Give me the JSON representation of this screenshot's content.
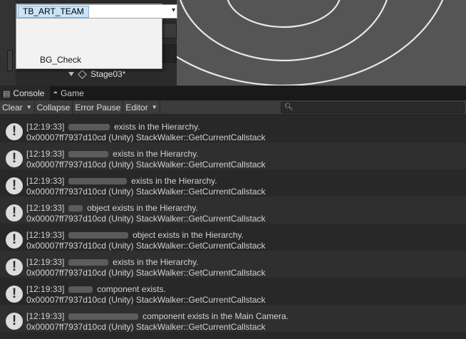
{
  "popup": {
    "selected_chip": "TB_ART_TEAM",
    "item": "BG_Check"
  },
  "hierarchy": {
    "visible_row": "Stage03*"
  },
  "tabs": [
    {
      "label": "Console",
      "icon": "console-icon",
      "active": true
    },
    {
      "label": "Game",
      "icon": "gamepad-icon",
      "active": false
    }
  ],
  "toolbar": {
    "clear": "Clear",
    "collapse": "Collapse",
    "error_pause": "Error Pause",
    "editor": "Editor",
    "search_placeholder": ""
  },
  "log_entries": [
    {
      "timestamp": "[12:19:33]",
      "message": "exists in the Hierarchy.",
      "trace": "0x00007ff7937d10cd (Unity) StackWalker::GetCurrentCallstack"
    },
    {
      "timestamp": "[12:19:33]",
      "message": "exists in the Hierarchy.",
      "trace": "0x00007ff7937d10cd (Unity) StackWalker::GetCurrentCallstack"
    },
    {
      "timestamp": "[12:19:33]",
      "message": "exists in the Hierarchy.",
      "trace": "0x00007ff7937d10cd (Unity) StackWalker::GetCurrentCallstack"
    },
    {
      "timestamp": "[12:19:33]",
      "message": "object exists in the Hierarchy.",
      "trace": "0x00007ff7937d10cd (Unity) StackWalker::GetCurrentCallstack"
    },
    {
      "timestamp": "[12:19:33]",
      "message": "object exists in the Hierarchy.",
      "trace": "0x00007ff7937d10cd (Unity) StackWalker::GetCurrentCallstack"
    },
    {
      "timestamp": "[12:19:33]",
      "message": "exists in the Hierarchy.",
      "trace": "0x00007ff7937d10cd (Unity) StackWalker::GetCurrentCallstack"
    },
    {
      "timestamp": "[12:19:33]",
      "message": "component exists.",
      "trace": "0x00007ff7937d10cd (Unity) StackWalker::GetCurrentCallstack"
    },
    {
      "timestamp": "[12:19:33]",
      "message": "component exists in the Main Camera.",
      "trace": "0x00007ff7937d10cd (Unity) StackWalker::GetCurrentCallstack"
    }
  ],
  "colors": {
    "console_bg": "#282828",
    "row_alt": "#2f2f2f",
    "toolbar_bg": "#3c3c3c",
    "chip_bg": "#cce4f7"
  }
}
